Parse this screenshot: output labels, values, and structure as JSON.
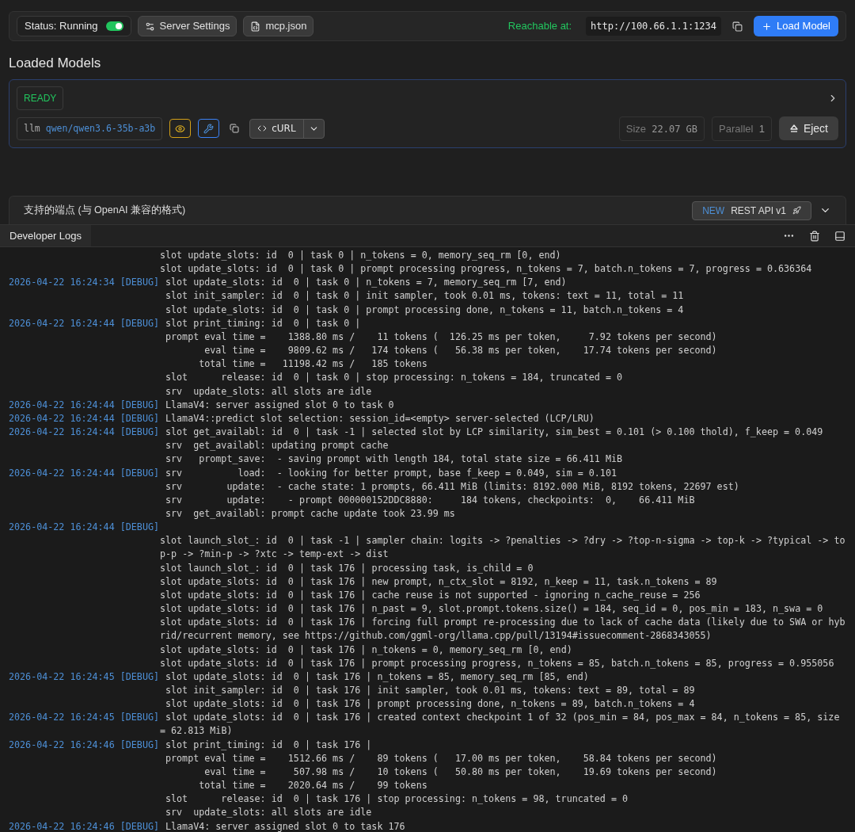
{
  "toolbar": {
    "status": {
      "label": "Status: Running",
      "on": true
    },
    "buttons": [
      "Server Settings",
      "mcp.json"
    ],
    "reachable_label": "Reachable at:",
    "url": "http://100.66.1.1:1234",
    "load_button": "Load Model"
  },
  "loaded_models": {
    "title": "Loaded Models",
    "models": [
      {
        "status": "READY",
        "type": "llm",
        "name": "qwen/qwen3.6-35b-a3b",
        "curl": "cURL",
        "size_label": "Size",
        "size": "22.07 GB",
        "parallel_label": "Parallel",
        "parallel": "1",
        "eject": "Eject"
      }
    ]
  },
  "endpoints": {
    "title": "支持的端点 (与 OpenAI 兼容的格式)",
    "badge": "NEW",
    "api": "REST API v1"
  },
  "developer_logs": {
    "tab": "Developer Logs",
    "rows": [
      {
        "kind": "wrap",
        "text": "slot update_slots: id  0 | task 0 | n_tokens = 0, memory_seq_rm [0, end)"
      },
      {
        "kind": "wrap",
        "text": "slot update_slots: id  0 | task 0 | prompt processing progress, n_tokens = 7, batch.n_tokens = 7, progress = 0.636364"
      },
      {
        "kind": "entry",
        "stamp": "2026-04-22 16:24:34 [DEBUG]",
        "text": "slot update_slots: id  0 | task 0 | n_tokens = 7, memory_seq_rm [7, end)"
      },
      {
        "kind": "entry",
        "text": "slot init_sampler: id  0 | task 0 | init sampler, took 0.01 ms, tokens: text = 11, total = 11"
      },
      {
        "kind": "entry",
        "text": "slot update_slots: id  0 | task 0 | prompt processing done, n_tokens = 11, batch.n_tokens = 4"
      },
      {
        "kind": "entry",
        "stamp": "2026-04-22 16:24:44 [DEBUG]",
        "text": "slot print_timing: id  0 | task 0 |"
      },
      {
        "kind": "entry",
        "text": "prompt eval time =    1388.80 ms /    11 tokens (  126.25 ms per token,     7.92 tokens per second)"
      },
      {
        "kind": "entry",
        "text": "       eval time =    9809.62 ms /   174 tokens (   56.38 ms per token,    17.74 tokens per second)"
      },
      {
        "kind": "entry",
        "text": "      total time =   11198.42 ms /   185 tokens"
      },
      {
        "kind": "entry",
        "text": "slot      release: id  0 | task 0 | stop processing: n_tokens = 184, truncated = 0"
      },
      {
        "kind": "entry",
        "text": "srv  update_slots: all slots are idle"
      },
      {
        "kind": "entry",
        "stamp": "2026-04-22 16:24:44 [DEBUG]",
        "text": "LlamaV4: server assigned slot 0 to task 0"
      },
      {
        "kind": "entry",
        "stamp": "2026-04-22 16:24:44 [DEBUG]",
        "text": "LlamaV4::predict slot selection: session_id=<empty> server-selected (LCP/LRU)"
      },
      {
        "kind": "entry",
        "stamp": "2026-04-22 16:24:44 [DEBUG]",
        "text": "slot get_availabl: id  0 | task -1 | selected slot by LCP similarity, sim_best = 0.101 (> 0.100 thold), f_keep = 0.049"
      },
      {
        "kind": "entry",
        "text": "srv  get_availabl: updating prompt cache"
      },
      {
        "kind": "entry",
        "text": "srv   prompt_save:  - saving prompt with length 184, total state size = 66.411 MiB"
      },
      {
        "kind": "entry",
        "stamp": "2026-04-22 16:24:44 [DEBUG]",
        "text": "srv          load:  - looking for better prompt, base f_keep = 0.049, sim = 0.101"
      },
      {
        "kind": "entry",
        "text": "srv        update:  - cache state: 1 prompts, 66.411 MiB (limits: 8192.000 MiB, 8192 tokens, 22697 est)"
      },
      {
        "kind": "entry",
        "text": "srv        update:    - prompt 000000152DDC8880:     184 tokens, checkpoints:  0,    66.411 MiB"
      },
      {
        "kind": "entry",
        "text": "srv  get_availabl: prompt cache update took 23.99 ms"
      },
      {
        "kind": "entry",
        "stamp": "2026-04-22 16:24:44 [DEBUG]"
      },
      {
        "kind": "wrap",
        "text": "slot launch_slot_: id  0 | task -1 | sampler chain: logits -> ?penalties -> ?dry -> ?top-n-sigma -> top-k -> ?typical -> to"
      },
      {
        "kind": "wrap",
        "text": "p-p -> ?min-p -> ?xtc -> temp-ext -> dist"
      },
      {
        "kind": "wrap",
        "text": "slot launch_slot_: id  0 | task 176 | processing task, is_child = 0"
      },
      {
        "kind": "wrap",
        "text": "slot update_slots: id  0 | task 176 | new prompt, n_ctx_slot = 8192, n_keep = 11, task.n_tokens = 89"
      },
      {
        "kind": "wrap",
        "text": "slot update_slots: id  0 | task 176 | cache reuse is not supported - ignoring n_cache_reuse = 256"
      },
      {
        "kind": "wrap",
        "text": "slot update_slots: id  0 | task 176 | n_past = 9, slot.prompt.tokens.size() = 184, seq_id = 0, pos_min = 183, n_swa = 0"
      },
      {
        "kind": "wrap",
        "text": "slot update_slots: id  0 | task 176 | forcing full prompt re-processing due to lack of cache data (likely due to SWA or hyb"
      },
      {
        "kind": "wrap",
        "text": "rid/recurrent memory, see https://github.com/ggml-org/llama.cpp/pull/13194#issuecomment-2868343055)"
      },
      {
        "kind": "wrap",
        "text": "slot update_slots: id  0 | task 176 | n_tokens = 0, memory_seq_rm [0, end)"
      },
      {
        "kind": "wrap",
        "text": "slot update_slots: id  0 | task 176 | prompt processing progress, n_tokens = 85, batch.n_tokens = 85, progress = 0.955056"
      },
      {
        "kind": "entry",
        "stamp": "2026-04-22 16:24:45 [DEBUG]",
        "text": "slot update_slots: id  0 | task 176 | n_tokens = 85, memory_seq_rm [85, end)"
      },
      {
        "kind": "entry",
        "text": "slot init_sampler: id  0 | task 176 | init sampler, took 0.01 ms, tokens: text = 89, total = 89"
      },
      {
        "kind": "entry",
        "text": "slot update_slots: id  0 | task 176 | prompt processing done, n_tokens = 89, batch.n_tokens = 4"
      },
      {
        "kind": "entry",
        "stamp": "2026-04-22 16:24:45 [DEBUG]",
        "text": "slot update_slots: id  0 | task 176 | created context checkpoint 1 of 32 (pos_min = 84, pos_max = 84, n_tokens = 85, size"
      },
      {
        "kind": "wrap",
        "text": "= 62.813 MiB)"
      },
      {
        "kind": "entry",
        "stamp": "2026-04-22 16:24:46 [DEBUG]",
        "text": "slot print_timing: id  0 | task 176 |"
      },
      {
        "kind": "entry",
        "text": "prompt eval time =    1512.66 ms /    89 tokens (   17.00 ms per token,    58.84 tokens per second)"
      },
      {
        "kind": "entry",
        "text": "       eval time =     507.98 ms /    10 tokens (   50.80 ms per token,    19.69 tokens per second)"
      },
      {
        "kind": "entry",
        "text": "      total time =    2020.64 ms /    99 tokens"
      },
      {
        "kind": "entry",
        "text": "slot      release: id  0 | task 176 | stop processing: n_tokens = 98, truncated = 0"
      },
      {
        "kind": "entry",
        "text": "srv  update_slots: all slots are idle"
      },
      {
        "kind": "entry",
        "stamp": "2026-04-22 16:24:46 [DEBUG]",
        "text": "LlamaV4: server assigned slot 0 to task 176"
      }
    ]
  }
}
